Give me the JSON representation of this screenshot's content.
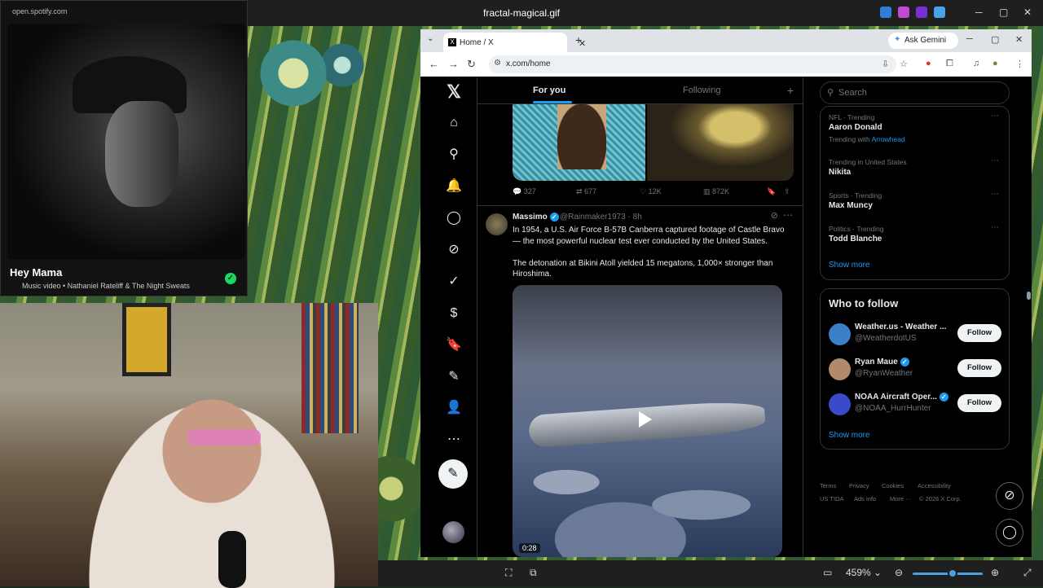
{
  "viewer": {
    "title": "fractal-magical.gif",
    "zoom": "459%",
    "zoom_level": 0.55,
    "app_icons": [
      "#2e7dd7",
      "#c04ad0",
      "#7a2fd0",
      "#4aa3e8"
    ],
    "minimize": "─",
    "maximize": "▢",
    "close": "✕"
  },
  "spotify": {
    "url": "open.spotify.com",
    "title": "Hey Mama",
    "subtitle": "Music video • Nathaniel Rateliff & The Night Sweats"
  },
  "browser": {
    "tab_title": "Home / X",
    "tab_close": "✕",
    "new_tab": "+",
    "ask_gemini": "Ask Gemini",
    "url": "x.com/home",
    "win_min": "─",
    "win_max": "▢",
    "win_close": "✕"
  },
  "x": {
    "tabs": {
      "for_you": "For you",
      "following": "Following"
    },
    "prev_post": {
      "replies": "327",
      "reposts": "677",
      "likes": "12K",
      "views": "872K"
    },
    "post": {
      "name": "Massimo",
      "handle": "@Rainmaker1973 · 8h",
      "text1": "In 1954, a U.S. Air Force B-57B Canberra captured footage of Castle Bravo — the most powerful nuclear test ever conducted by the United States.",
      "text2": "The detonation at Bikini Atoll yielded 15 megatons, 1,000× stronger than Hiroshima.",
      "video_time": "0:28"
    },
    "search_placeholder": "Search",
    "trends": [
      {
        "context": "NFL · Trending",
        "name": "Aaron Donald",
        "sub_prefix": "Trending with ",
        "sub_link": "Arrowhead"
      },
      {
        "context": "Trending in United States",
        "name": "Nikita"
      },
      {
        "context": "Sports · Trending",
        "name": "Max Muncy"
      },
      {
        "context": "Politics · Trending",
        "name": "Todd Blanche"
      }
    ],
    "show_more": "Show more",
    "who_to_follow": "Who to follow",
    "follow_label": "Follow",
    "suggestions": [
      {
        "name": "Weather.us - Weather ...",
        "handle": "@WeatherdotUS",
        "color": "#3a7fc8"
      },
      {
        "name": "Ryan Maue",
        "handle": "@RyanWeather",
        "color": "#b08a6a"
      },
      {
        "name": "NOAA Aircraft Oper...",
        "handle": "@NOAA_HurrHunter",
        "color": "#3a4ac8"
      }
    ],
    "footer": {
      "terms": "Terms",
      "privacy": "Privacy",
      "cookies": "Cookies",
      "accessibility": "Accessibility",
      "us_tida": "US TIDA",
      "ads_info": "Ads info",
      "more": "More ···",
      "copyright": "© 2026 X Corp."
    }
  }
}
